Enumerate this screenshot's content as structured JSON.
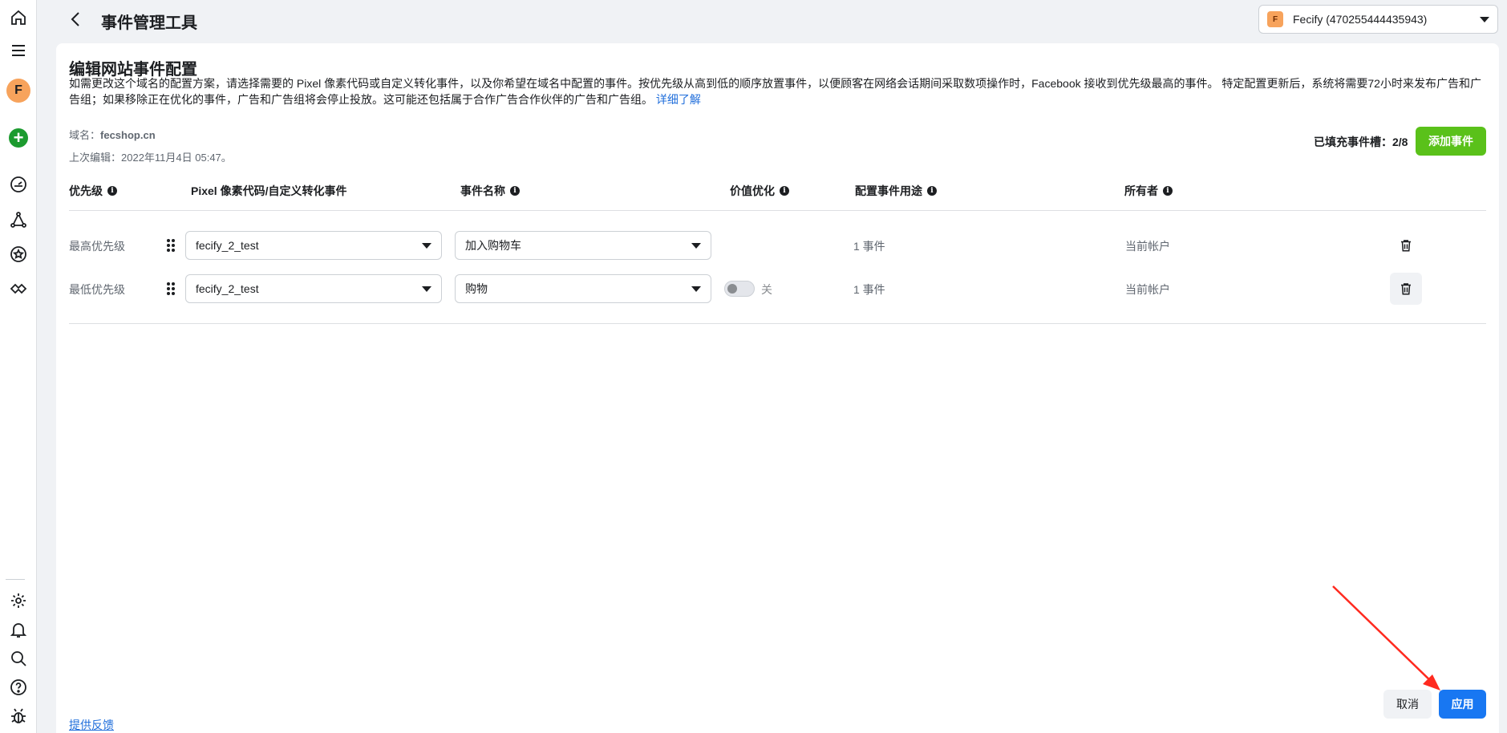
{
  "header": {
    "title": "事件管理工具",
    "account_badge": "F",
    "account_name": "Fecify (470255444435943)"
  },
  "rail": {
    "avatar_letter": "F",
    "icons": [
      "home-icon",
      "menu-icon",
      "avatar",
      "add-icon",
      "dashboard-icon",
      "graph-icon",
      "star-icon",
      "partner-icon",
      "settings-icon",
      "bell-icon",
      "search-icon",
      "help-icon",
      "bug-icon"
    ]
  },
  "page": {
    "title": "编辑网站事件配置",
    "description": "如需更改这个域名的配置方案，请选择需要的 Pixel 像素代码或自定义转化事件，以及你希望在域名中配置的事件。按优先级从高到低的顺序放置事件，以便顾客在网络会话期间采取数项操作时，Facebook 接收到优先级最高的事件。 特定配置更新后，系统将需要72小时来发布广告和广告组；如果移除正在优化的事件，广告和广告组将会停止投放。这可能还包括属于合作广告合作伙伴的广告和广告组。",
    "learn_more": "详细了解",
    "domain_label": "域名：",
    "domain_value": "fecshop.cn",
    "last_edit": "上次编辑：2022年11月4日 05:47。",
    "slots": "已填充事件槽：2/8",
    "add_event": "添加事件"
  },
  "table": {
    "columns": [
      "优先级",
      "Pixel 像素代码/自定义转化事件",
      "事件名称",
      "价值优化",
      "配置事件用途",
      "所有者"
    ],
    "rows": [
      {
        "priority": "最高优先级",
        "pixel": "fecify_2_test",
        "event": "加入购物车",
        "value_opt": "",
        "usage": "1 事件",
        "owner": "当前帐户"
      },
      {
        "priority": "最低优先级",
        "pixel": "fecify_2_test",
        "event": "购物",
        "value_opt": "关",
        "usage": "1 事件",
        "owner": "当前帐户"
      }
    ]
  },
  "footer": {
    "cancel": "取消",
    "apply": "应用",
    "feedback": "提供反馈"
  },
  "colors": {
    "primary": "#1877f2",
    "add_button": "#5ac11a",
    "annotation_arrow": "#ff2a1f"
  }
}
